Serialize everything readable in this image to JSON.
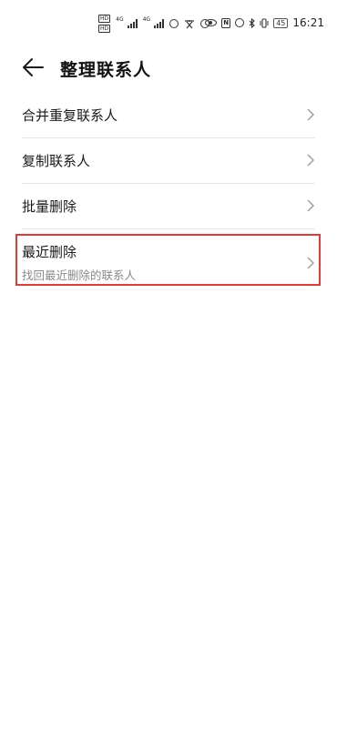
{
  "status_bar": {
    "sim1": "HD",
    "sim2": "HD",
    "net1": "4G",
    "net2": "4G",
    "battery": "45",
    "time": "16:21",
    "icons": [
      "sim-icon",
      "signal-icon",
      "weibo-icon",
      "translate-icon",
      "eye-icon",
      "nfc-icon",
      "alarm-icon",
      "bluetooth-icon",
      "vibrate-icon",
      "battery-icon"
    ]
  },
  "header": {
    "title": "整理联系人",
    "back_icon": "back-arrow-icon"
  },
  "list": {
    "items": [
      {
        "label": "合并重复联系人"
      },
      {
        "label": "复制联系人"
      },
      {
        "label": "批量删除"
      },
      {
        "label": "最近删除",
        "subtitle": "找回最近删除的联系人"
      }
    ]
  },
  "colors": {
    "highlight": "#e53935",
    "divider": "#e6e6e6",
    "subtitle": "#8a8a8a"
  }
}
